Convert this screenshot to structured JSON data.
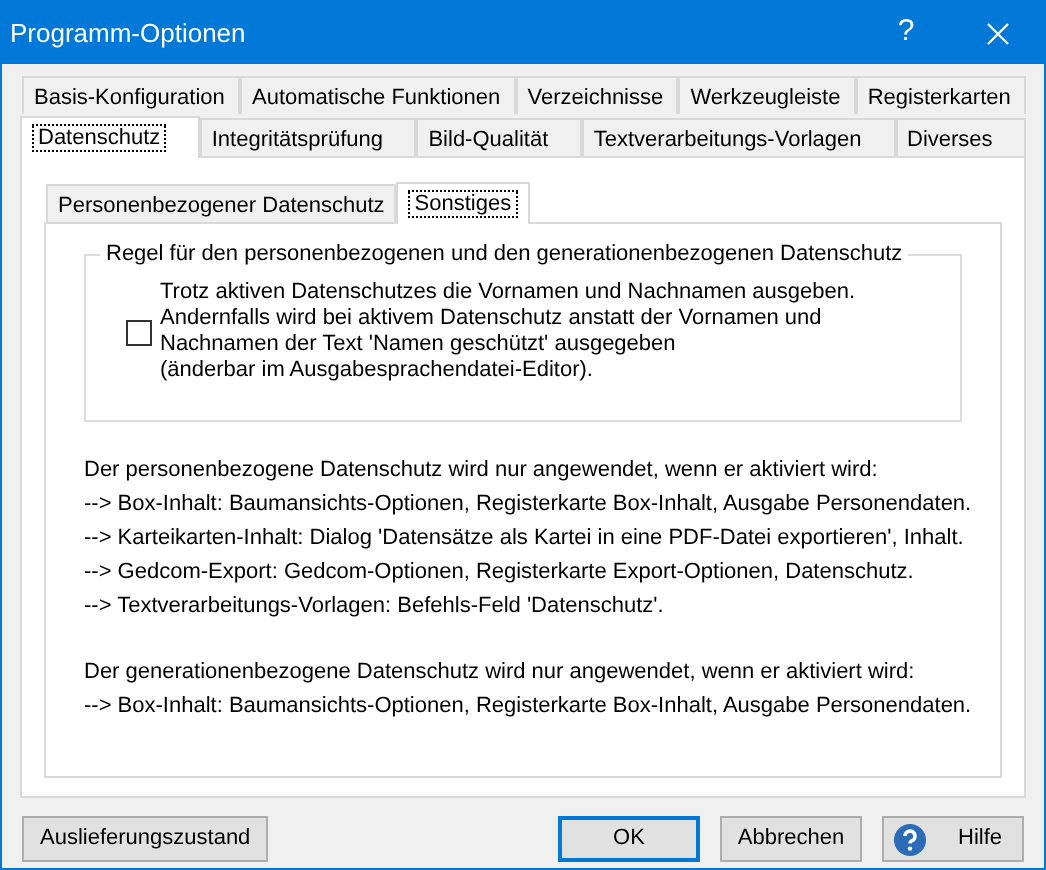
{
  "window": {
    "title": "Programm-Optionen",
    "help_glyph": "?"
  },
  "tab_rows": [
    [
      {
        "label": "Basis-Konfiguration",
        "selected": false
      },
      {
        "label": "Automatische Funktionen",
        "selected": false
      },
      {
        "label": "Verzeichnisse",
        "selected": false
      },
      {
        "label": "Werkzeugleiste",
        "selected": false
      },
      {
        "label": "Registerkarten",
        "selected": false
      }
    ],
    [
      {
        "label": "Datenschutz",
        "selected": true
      },
      {
        "label": "Integritätsprüfung",
        "selected": false
      },
      {
        "label": "Bild-Qualität",
        "selected": false
      },
      {
        "label": "Textverarbeitungs-Vorlagen",
        "selected": false
      },
      {
        "label": "Diverses",
        "selected": false
      }
    ]
  ],
  "subtabs": [
    {
      "label": "Personenbezogener Datenschutz",
      "selected": false
    },
    {
      "label": "Sonstiges",
      "selected": true
    }
  ],
  "group": {
    "title": "Regel für den personenbezogenen und den generationenbezogenen Datenschutz",
    "checkbox": {
      "checked": false,
      "lines": [
        "Trotz aktiven Datenschutzes die Vornamen und Nachnamen ausgeben.",
        "Andernfalls wird bei aktivem Datenschutz anstatt der Vornamen und",
        "Nachnamen der Text 'Namen geschützt' ausgegeben",
        "(änderbar im Ausgabesprachendatei-Editor)."
      ]
    }
  },
  "info_blocks": [
    [
      "Der personenbezogene Datenschutz wird nur angewendet, wenn er aktiviert wird:",
      "--> Box-Inhalt: Baumansichts-Optionen, Registerkarte Box-Inhalt, Ausgabe Personendaten.",
      "--> Karteikarten-Inhalt: Dialog 'Datensätze als Kartei in eine PDF-Datei exportieren', Inhalt.",
      "--> Gedcom-Export: Gedcom-Optionen, Registerkarte Export-Optionen, Datenschutz.",
      "--> Textverarbeitungs-Vorlagen: Befehls-Feld 'Datenschutz'."
    ],
    [
      "Der generationenbezogene Datenschutz wird nur angewendet, wenn er aktiviert wird:",
      "--> Box-Inhalt: Baumansichts-Optionen, Registerkarte Box-Inhalt, Ausgabe Personendaten."
    ]
  ],
  "buttons": {
    "reset": "Auslieferungszustand",
    "ok": "OK",
    "cancel": "Abbrechen",
    "help": "Hilfe"
  }
}
